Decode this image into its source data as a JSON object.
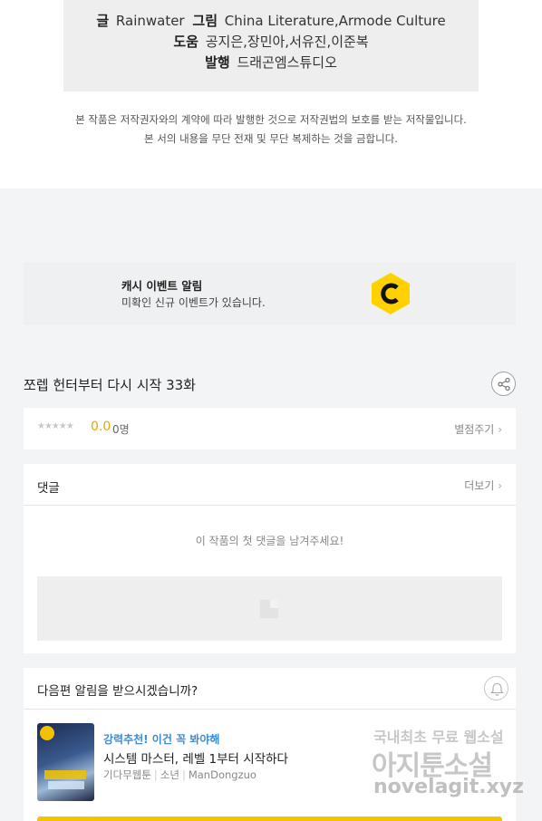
{
  "credits": {
    "writer_label": "글",
    "writer": "Rainwater",
    "art_label": "그림",
    "art": "China Literature,Armode Culture",
    "assist_label": "도움",
    "assist": "공지은,장민아,서유진,이준복",
    "publisher_label": "발행",
    "publisher": "드래곤엠스튜디오"
  },
  "copyright": {
    "line1": "본 작품은 저작권자와의 계약에 따라 발행한 것으로 저작권법의 보호를 받는 저작물입니다.",
    "line2": "본 서의 내용을 무단 전재 및 무단 복제하는 것을 금합니다."
  },
  "event": {
    "title": "캐시 이벤트 알림",
    "subtitle": "미확인 신규 이벤트가 있습니다.",
    "icon": "cash-c-icon",
    "accent": "#ffd100"
  },
  "episode": {
    "title": "쪼렙 헌터부터 다시 시작 33화",
    "share_icon": "share-icon"
  },
  "rating": {
    "stars": "★★★★★",
    "score": "0.0",
    "count": "0명",
    "action": "별점주기"
  },
  "comments": {
    "heading": "댓글",
    "more": "더보기",
    "empty_message": "이 작품의 첫 댓글을 남겨주세요!"
  },
  "next": {
    "heading": "다음편 알림을 받으시겠습니까?",
    "bell_icon": "bell-icon"
  },
  "recommendation": {
    "tag": "강력추천! 이건 꼭 봐야해",
    "title": "시스템 마스터, 레벨 1부터 시작하다",
    "meta": [
      "기다무웹툰",
      "소년",
      "ManDongzuo"
    ],
    "accent": "#3c8bd8"
  },
  "watermark": {
    "line1": "국내최초 무료 웹소설",
    "line2": "아지툰소설",
    "line3": "novelagit.xyz"
  }
}
